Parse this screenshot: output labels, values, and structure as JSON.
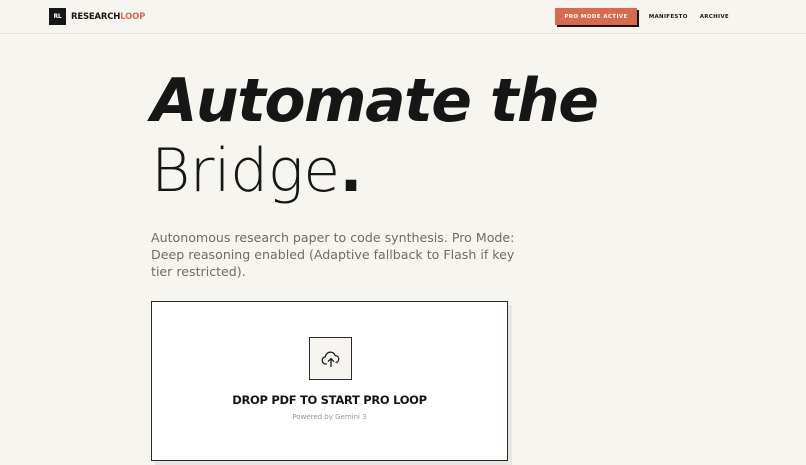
{
  "header": {
    "logo_mark": "RL",
    "logo_text_primary": "RESEARCH",
    "logo_text_accent": "LOOP",
    "pro_badge": "PRO MODE ACTIVE",
    "nav_links": [
      "MANIFESTO",
      "ARCHIVE"
    ]
  },
  "hero": {
    "title_line1": "Automate the",
    "title_line2": "Bridge",
    "title_dot": ".",
    "subtitle": "Autonomous research paper to code synthesis. Pro Mode: Deep reasoning enabled (Adaptive fallback to Flash if key tier restricted)."
  },
  "dropzone": {
    "icon": "cloud-upload-icon",
    "label": "DROP PDF TO START PRO LOOP",
    "powered_by": "Powered by Gemini 3"
  },
  "colors": {
    "background": "#f7f5f0",
    "accent": "#d9694f",
    "ink": "#161616",
    "muted": "#6f6c67"
  }
}
